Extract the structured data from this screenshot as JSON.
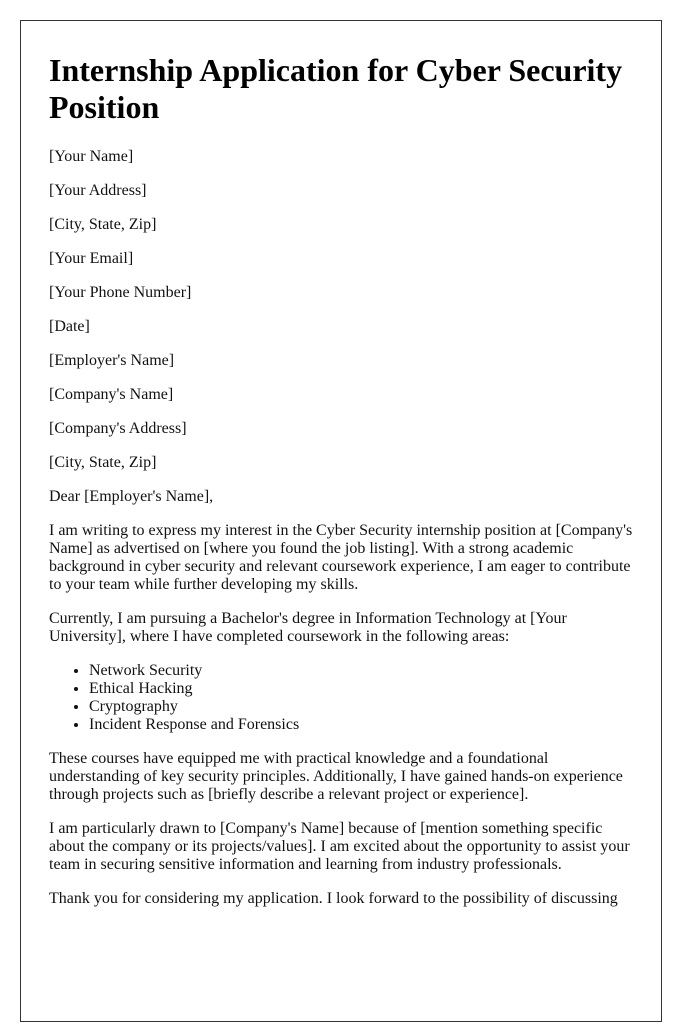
{
  "document": {
    "title": "Internship Application for Cyber Security Position",
    "sender_block": [
      "[Your Name]",
      "[Your Address]",
      "[City, State, Zip]",
      "[Your Email]",
      "[Your Phone Number]",
      "[Date]"
    ],
    "recipient_block": [
      "[Employer's Name]",
      "[Company's Name]",
      "[Company's Address]",
      "[City, State, Zip]"
    ],
    "salutation": "Dear [Employer's Name],",
    "paragraphs": [
      "I am writing to express my interest in the Cyber Security internship position at [Company's Name] as advertised on [where you found the job listing]. With a strong academic background in cyber security and relevant coursework experience, I am eager to contribute to your team while further developing my skills.",
      "Currently, I am pursuing a Bachelor's degree in Information Technology at [Your University], where I have completed coursework in the following areas:"
    ],
    "coursework": [
      "Network Security",
      "Ethical Hacking",
      "Cryptography",
      "Incident Response and Forensics"
    ],
    "paragraphs_after": [
      "These courses have equipped me with practical knowledge and a foundational understanding of key security principles. Additionally, I have gained hands-on experience through projects such as [briefly describe a relevant project or experience].",
      "I am particularly drawn to [Company's Name] because of [mention something specific about the company or its projects/values]. I am excited about the opportunity to assist your team in securing sensitive information and learning from industry professionals.",
      "Thank you for considering my application. I look forward to the possibility of discussing"
    ]
  }
}
